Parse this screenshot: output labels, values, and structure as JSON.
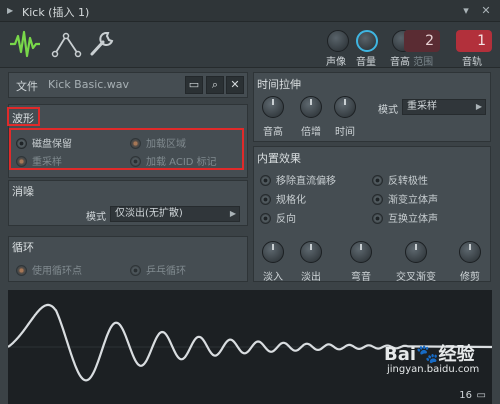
{
  "window": {
    "title": "Kick (插入 1)",
    "min_symbol": "▾",
    "close_symbol": "✕"
  },
  "toolbar": {
    "tools": [
      "waveform-tool",
      "envelope-tool",
      "settings-tool"
    ],
    "pan_label": "声像",
    "volume_label": "音量",
    "pitch_label": "音高",
    "range_label": "范围",
    "range_value": "2",
    "channel_label": "音轨",
    "channel_value": "1"
  },
  "file": {
    "label": "文件",
    "name": "Kick Basic.wav"
  },
  "waveform_section": {
    "title": "波形",
    "options": [
      {
        "label": "磁盘保留",
        "state": "on",
        "enabled": true
      },
      {
        "label": "加载区域",
        "state": "orange",
        "enabled": false
      },
      {
        "label": "重采样",
        "state": "orange",
        "enabled": false
      },
      {
        "label": "加载 ACID 标记",
        "state": "off",
        "enabled": false
      }
    ]
  },
  "declick": {
    "title": "消噪",
    "mode_label": "模式",
    "mode_value": "仅淡出(无扩散)"
  },
  "loop": {
    "title": "循环",
    "options": [
      {
        "label": "使用循环点",
        "enabled": false
      },
      {
        "label": "乒乓循环",
        "enabled": false
      }
    ]
  },
  "time_stretch": {
    "title": "时间拉伸",
    "knobs": [
      "音高",
      "倍增",
      "时间"
    ],
    "mode_label": "模式",
    "mode_value": "重采样"
  },
  "effects": {
    "title": "内置效果",
    "options": [
      "移除直流偏移",
      "反转极性",
      "规格化",
      "渐变立体声",
      "反向",
      "互换立体声"
    ],
    "knobs": [
      "淡入",
      "淡出",
      "弯音",
      "交叉渐变",
      "修剪"
    ]
  },
  "footer": {
    "zoom_value": "16"
  },
  "watermark": {
    "brand": "Bai",
    "brand2": "经验",
    "url": "jingyan.baidu.com"
  },
  "colors": {
    "accent": "#3fb6e2",
    "highlight": "#e02a2a",
    "wave": "#d9dde0",
    "tool_active": "#79d84a"
  }
}
